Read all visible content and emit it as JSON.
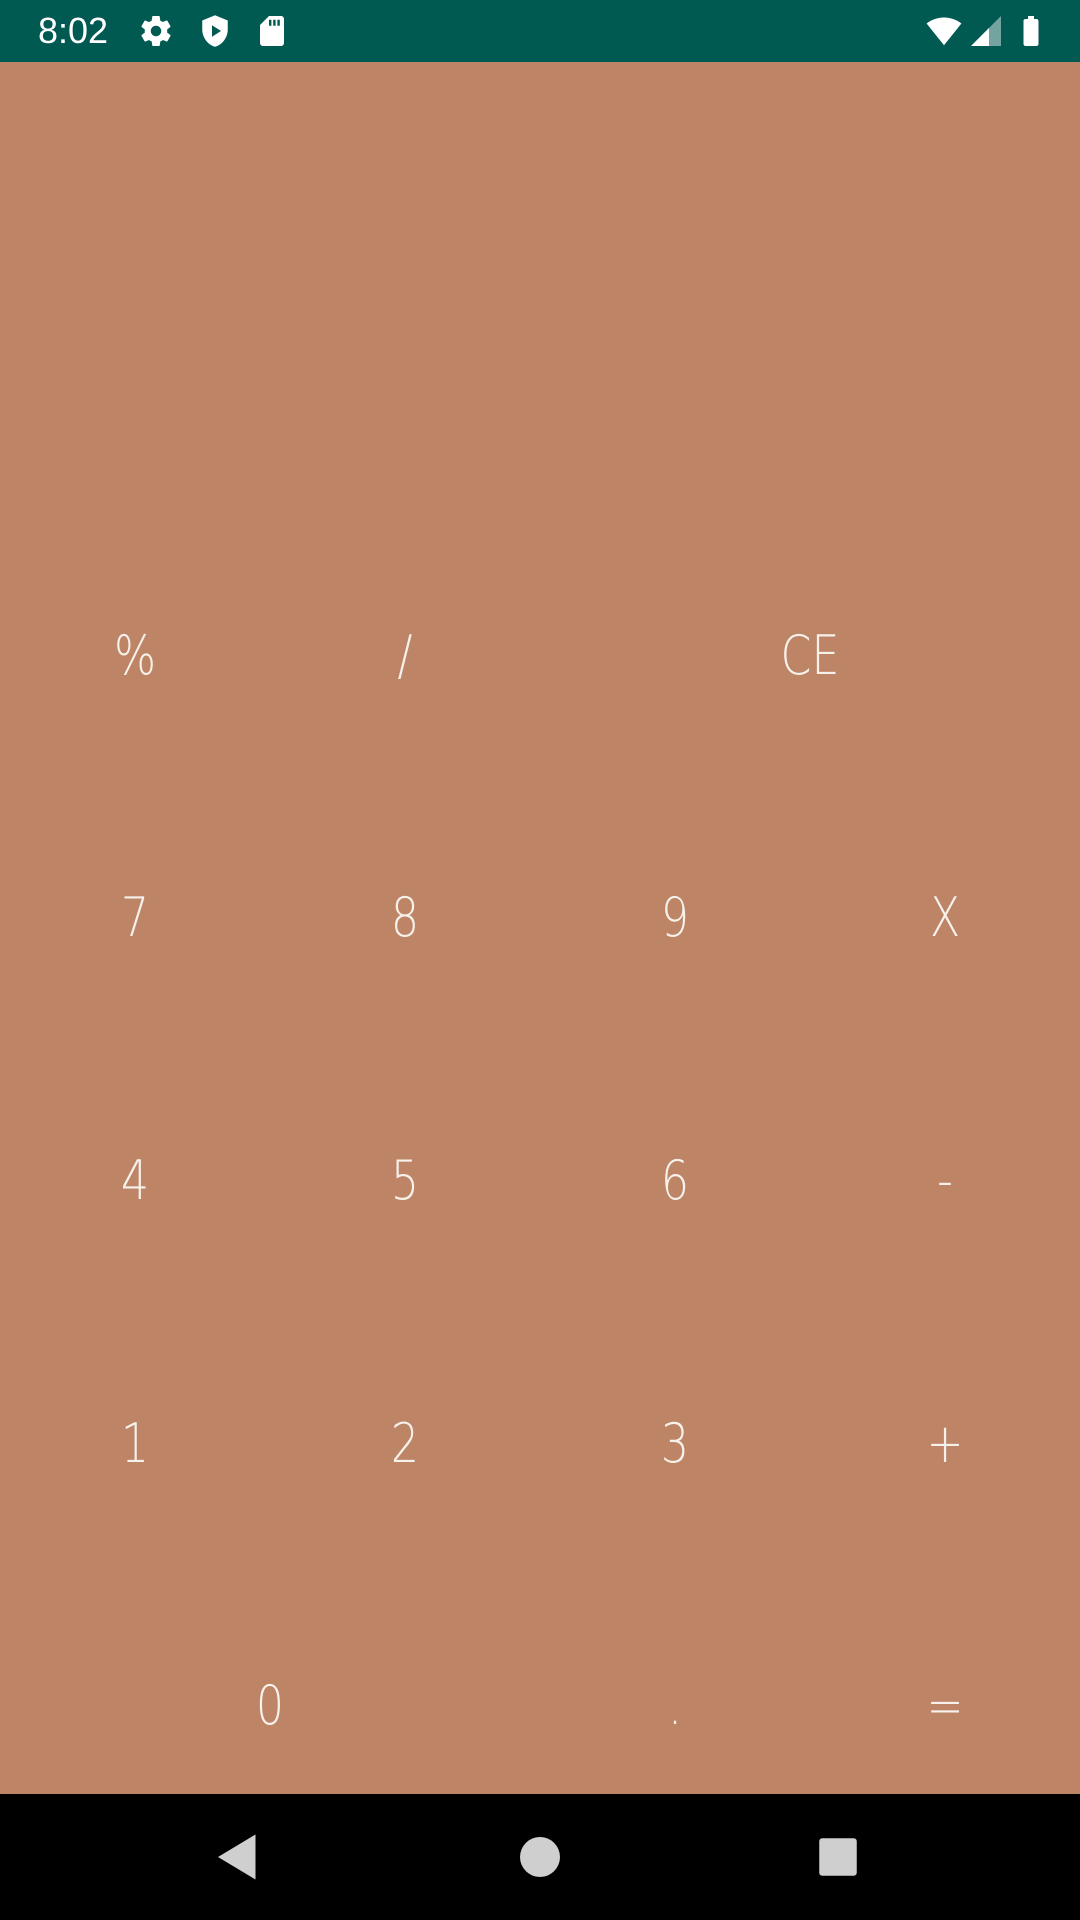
{
  "status_bar": {
    "time": "8:02",
    "background": "#005a52",
    "left_icons": [
      "settings-gear-icon",
      "shield-play-icon",
      "sd-card-icon"
    ],
    "right_icons": [
      "wifi-icon",
      "cell-signal-icon",
      "battery-icon"
    ]
  },
  "display": {
    "value": ""
  },
  "keypad": {
    "background": "#bd8466",
    "text_color": "#f7f1ec",
    "rows": [
      [
        "%",
        "/",
        "CE"
      ],
      [
        "7",
        "8",
        "9",
        "X"
      ],
      [
        "4",
        "5",
        "6",
        "-"
      ],
      [
        "1",
        "2",
        "3",
        "+"
      ],
      [
        "0",
        ".",
        "="
      ]
    ]
  },
  "nav_bar": {
    "buttons": [
      "back-icon",
      "home-icon",
      "recents-icon"
    ]
  }
}
